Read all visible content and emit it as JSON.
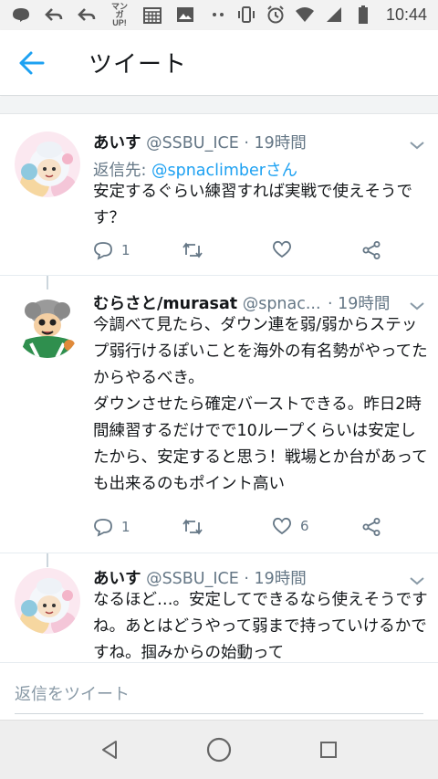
{
  "status_bar": {
    "time": "10:44",
    "left_icons": [
      "line-icon",
      "back-arrow-icon",
      "back-arrow-icon",
      "manga-up-icon",
      "calendar-icon",
      "image-icon",
      "dots-icon"
    ],
    "manga_label": "マンガ UP!",
    "right_icons": [
      "vibrate-icon",
      "alarm-icon",
      "wifi-icon",
      "signal-icon",
      "battery-icon"
    ]
  },
  "header": {
    "title": "ツイート"
  },
  "tweets": [
    {
      "name": "あいす",
      "handle": "@SSBU_ICE · 19時間",
      "reply_prefix": "返信先: ",
      "reply_to": "@spnaclimberさん",
      "text": "安定するぐらい練習すれば実戦で使えそうです？",
      "replies": "1",
      "retweets": "",
      "likes": ""
    },
    {
      "name": "むらさと/murasat",
      "handle": "@spnac...",
      "time": "· 19時間",
      "text": "今調べて見たら、ダウン連を弱/弱からステップ弱行けるぽいことを海外の有名勢がやってたからやるべき。\nダウンさせたら確定バーストできる。昨日2時間練習するだけでで10ループくらいは安定したから、安定すると思う！戦場とか台があっても出来るのもポイント高い",
      "replies": "1",
      "retweets": "",
      "likes": "6"
    },
    {
      "name": "あいす",
      "handle": "@SSBU_ICE · 19時間",
      "text": "なるほど…。安定してできるなら使えそうですね。あとはどうやって弱まで持っていけるかですね。掴みからの始動って"
    }
  ],
  "reply_bar": {
    "placeholder": "返信をツイート"
  },
  "colors": {
    "accent": "#1da1f2",
    "secondary_text": "#657786",
    "background": "#ffffff"
  }
}
